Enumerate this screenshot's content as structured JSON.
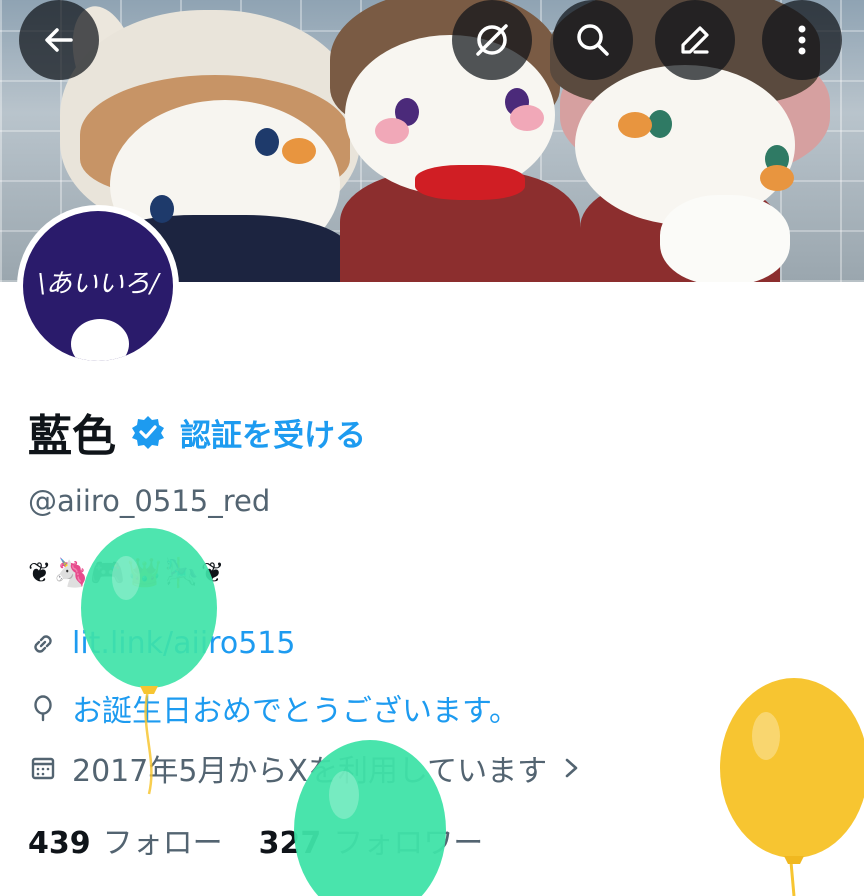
{
  "header": {
    "back_icon": "arrow-left-icon",
    "actions": [
      "translate-off-icon",
      "search-icon",
      "edit-icon",
      "more-vertical-icon"
    ]
  },
  "avatar": {
    "text": "\\あいいろ/"
  },
  "profile": {
    "name": "藍色",
    "verify_label": "認証を受ける",
    "handle": "@aiiro_0515_red",
    "bio": "❦🦄🎮👑🎠❦",
    "link": "lit.link/aiiro515",
    "birthday": "お誕生日おめでとうございます。",
    "joined": "2017年5月からXを利用しています"
  },
  "stats": {
    "following_count": "439",
    "following_label": "フォロー",
    "followers_count": "327",
    "followers_label": "フォロワー"
  },
  "colors": {
    "accent": "#1d9bf0",
    "text": "#0f1419",
    "muted": "#536471",
    "balloon_green": "#3fe3a8",
    "balloon_yellow": "#f7c531"
  }
}
